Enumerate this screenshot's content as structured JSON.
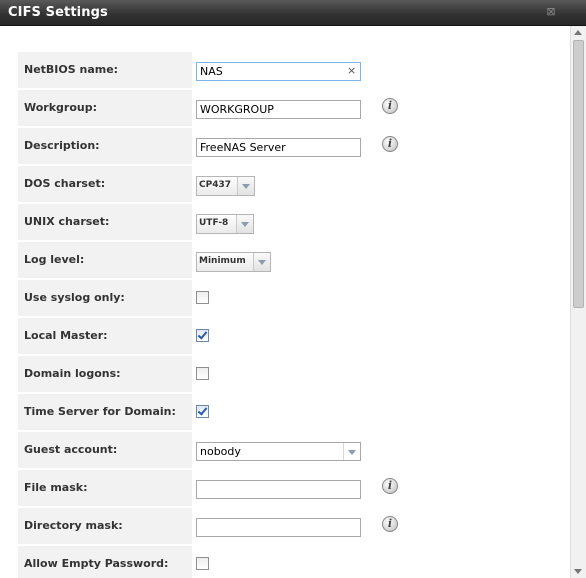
{
  "window": {
    "title": "CIFS Settings",
    "close_icon": "close-icon"
  },
  "fields": [
    {
      "key": "netbios",
      "label": "NetBIOS name:",
      "type": "text",
      "value": "NAS",
      "focused": true,
      "clear_glyph": "×"
    },
    {
      "key": "workgroup",
      "label": "Workgroup:",
      "type": "text",
      "value": "WORKGROUP",
      "info": "i"
    },
    {
      "key": "description",
      "label": "Description:",
      "type": "text",
      "value": "FreeNAS Server",
      "info": "i"
    },
    {
      "key": "dos_charset",
      "label": "DOS charset:",
      "type": "select",
      "value": "CP437"
    },
    {
      "key": "unix_charset",
      "label": "UNIX charset:",
      "type": "select",
      "value": "UTF-8"
    },
    {
      "key": "log_level",
      "label": "Log level:",
      "type": "select",
      "value": "Minimum"
    },
    {
      "key": "use_syslog",
      "label": "Use syslog only:",
      "type": "checkbox",
      "checked": false
    },
    {
      "key": "local_master",
      "label": "Local Master:",
      "type": "checkbox",
      "checked": true
    },
    {
      "key": "domain_logons",
      "label": "Domain logons:",
      "type": "checkbox",
      "checked": false
    },
    {
      "key": "time_server",
      "label": "Time Server for Domain:",
      "type": "checkbox",
      "checked": true
    },
    {
      "key": "guest_account",
      "label": "Guest account:",
      "type": "wide-select",
      "value": "nobody"
    },
    {
      "key": "file_mask",
      "label": "File mask:",
      "type": "text",
      "value": "",
      "info": "i"
    },
    {
      "key": "directory_mask",
      "label": "Directory mask:",
      "type": "text",
      "value": "",
      "info": "i"
    },
    {
      "key": "allow_empty_password",
      "label": "Allow Empty Password:",
      "type": "checkbox",
      "checked": false
    }
  ]
}
